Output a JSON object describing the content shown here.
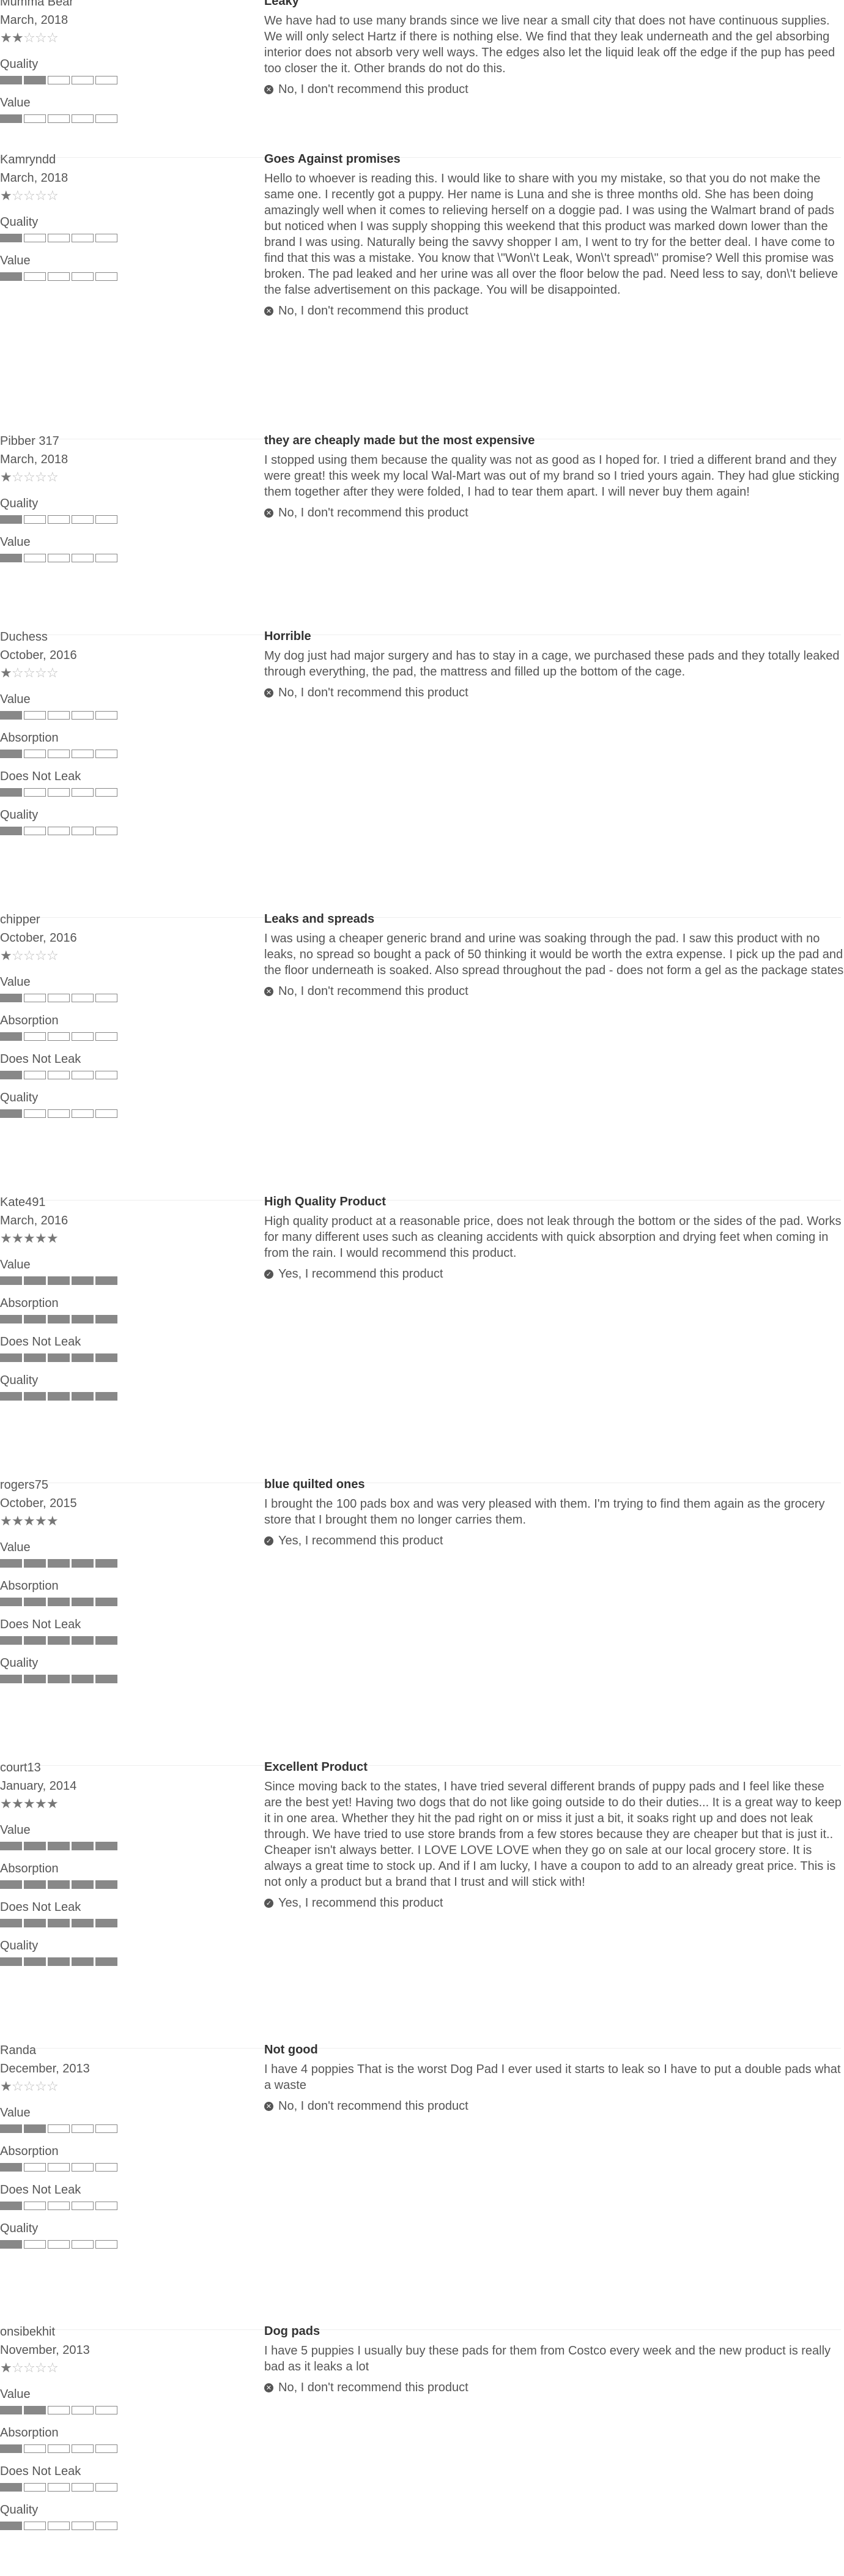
{
  "reviews": [
    {
      "author": "Mumma Bear",
      "date": "March, 2018",
      "stars": 2,
      "metrics": [
        {
          "label": "Quality",
          "value": 2
        },
        {
          "label": "Value",
          "value": 1
        }
      ],
      "title": "Leaky",
      "body": "We have had to use many brands since we live near a small city that does not have continuous supplies. We will only select Hartz if there is nothing else. We find that they leak underneath and the gel absorbing interior does not absorb very well ways. The edges also let the liquid leak off the edge if the pup has peed too closer the it. Other brands do not do this.",
      "recommend": false,
      "recommend_text": "No, I don't recommend this product"
    },
    {
      "author": "Kamryndd",
      "date": "March, 2018",
      "stars": 1,
      "metrics": [
        {
          "label": "Quality",
          "value": 1
        },
        {
          "label": "Value",
          "value": 1
        }
      ],
      "title": "Goes Against promises",
      "body": "Hello to whoever is reading this. I would like to share with you my mistake, so that you do not make the same one. I recently got a puppy. Her name is Luna and she is three months old. She has been doing amazingly well when it comes to relieving herself on a doggie pad. I was using the Walmart brand of pads but noticed when I was supply shopping this weekend that this product was marked down lower than the brand I was using. Naturally being the savvy shopper I am, I went to try for the better deal. I have come to find that this was a mistake. You know that \\\"Won\\'t Leak, Won\\'t spread\\\" promise? Well this promise was broken. The pad leaked and her urine was all over the floor below the pad. Need less to say, don\\'t believe the false advertisement on this package. You will be disappointed.",
      "recommend": false,
      "recommend_text": "No, I don't recommend this product"
    },
    {
      "author": "Pibber 317",
      "date": "March, 2018",
      "stars": 1,
      "metrics": [
        {
          "label": "Quality",
          "value": 1
        },
        {
          "label": "Value",
          "value": 1
        }
      ],
      "title": "they are cheaply made but the most expensive",
      "body": "I stopped using them because the quality was not as good as I hoped for. I tried a different brand and they were great! this week my local Wal-Mart was out of my brand so I tried yours again. They had glue sticking them together after they were folded, I had to tear them apart. I will never buy them again!",
      "recommend": false,
      "recommend_text": "No, I don't recommend this product"
    },
    {
      "author": "Duchess",
      "date": "October, 2016",
      "stars": 1,
      "metrics": [
        {
          "label": "Value",
          "value": 1
        },
        {
          "label": "Absorption",
          "value": 1
        },
        {
          "label": "Does Not Leak",
          "value": 1
        },
        {
          "label": "Quality",
          "value": 1
        }
      ],
      "title": "Horrible",
      "body": "My dog just had major surgery and has to stay in a cage, we purchased these pads and they totally leaked through everything, the pad, the mattress and filled up the bottom of the cage.",
      "recommend": false,
      "recommend_text": "No, I don't recommend this product"
    },
    {
      "author": "chipper",
      "date": "October, 2016",
      "stars": 1,
      "metrics": [
        {
          "label": "Value",
          "value": 1
        },
        {
          "label": "Absorption",
          "value": 1
        },
        {
          "label": "Does Not Leak",
          "value": 1
        },
        {
          "label": "Quality",
          "value": 1
        }
      ],
      "title": "Leaks and spreads",
      "body": "I was using a cheaper generic brand and urine was soaking through the pad. I saw this product with no leaks, no spread so bought a pack of 50 thinking it would be worth the extra expense. I pick up the pad and the floor underneath is soaked. Also spread throughout the pad - does not form a gel as the package states",
      "recommend": false,
      "recommend_text": "No, I don't recommend this product"
    },
    {
      "author": "Kate491",
      "date": "March, 2016",
      "stars": 5,
      "metrics": [
        {
          "label": "Value",
          "value": 5
        },
        {
          "label": "Absorption",
          "value": 5
        },
        {
          "label": "Does Not Leak",
          "value": 5
        },
        {
          "label": "Quality",
          "value": 5
        }
      ],
      "title": "High Quality Product",
      "body": "High quality product at a reasonable price, does not leak through the bottom or the sides of the pad. Works for many different uses such as cleaning accidents with quick absorption and drying feet when coming in from the rain. I would recommend this product.",
      "recommend": true,
      "recommend_text": "Yes, I recommend this product"
    },
    {
      "author": "rogers75",
      "date": "October, 2015",
      "stars": 5,
      "metrics": [
        {
          "label": "Value",
          "value": 5
        },
        {
          "label": "Absorption",
          "value": 5
        },
        {
          "label": "Does Not Leak",
          "value": 5
        },
        {
          "label": "Quality",
          "value": 5
        }
      ],
      "title": "blue quilted ones",
      "body": "I brought the 100 pads box and was very pleased with them. I'm trying to find them again as the grocery store that I brought them no longer carries them.",
      "recommend": true,
      "recommend_text": "Yes, I recommend this product"
    },
    {
      "author": "court13",
      "date": "January, 2014",
      "stars": 5,
      "metrics": [
        {
          "label": "Value",
          "value": 5
        },
        {
          "label": "Absorption",
          "value": 5
        },
        {
          "label": "Does Not Leak",
          "value": 5
        },
        {
          "label": "Quality",
          "value": 5
        }
      ],
      "title": "Excellent Product",
      "body": "Since moving back to the states, I have tried several different brands of puppy pads and I feel like these are the best yet! Having two dogs that do not like going outside to do their duties... It is a great way to keep it in one area. Whether they hit the pad right on or miss it just a bit, it soaks right up and does not leak through. We have tried to use store brands from a few stores because they are cheaper but that is just it.. Cheaper isn't always better. I LOVE LOVE LOVE when they go on sale at our local grocery store. It is always a great time to stock up. And if I am lucky, I have a coupon to add to an already great price. This is not only a product but a brand that I trust and will stick with!",
      "recommend": true,
      "recommend_text": "Yes, I recommend this product"
    },
    {
      "author": "Randa",
      "date": "December, 2013",
      "stars": 1,
      "metrics": [
        {
          "label": "Value",
          "value": 2
        },
        {
          "label": "Absorption",
          "value": 1
        },
        {
          "label": "Does Not Leak",
          "value": 1
        },
        {
          "label": "Quality",
          "value": 1
        }
      ],
      "title": "Not good",
      "body": "I have 4 poppies That is the worst Dog Pad I ever used it starts to leak so I have to put a double pads what a waste",
      "recommend": false,
      "recommend_text": "No, I don't recommend this product"
    },
    {
      "author": "onsibekhit",
      "date": "November, 2013",
      "stars": 1,
      "metrics": [
        {
          "label": "Value",
          "value": 2
        },
        {
          "label": "Absorption",
          "value": 1
        },
        {
          "label": "Does Not Leak",
          "value": 1
        },
        {
          "label": "Quality",
          "value": 1
        }
      ],
      "title": "Dog pads",
      "body": "I have 5 puppies I usually buy these pads for them from Costco every week and the new product is really bad as it leaks a lot",
      "recommend": false,
      "recommend_text": "No, I don't recommend this product"
    }
  ]
}
